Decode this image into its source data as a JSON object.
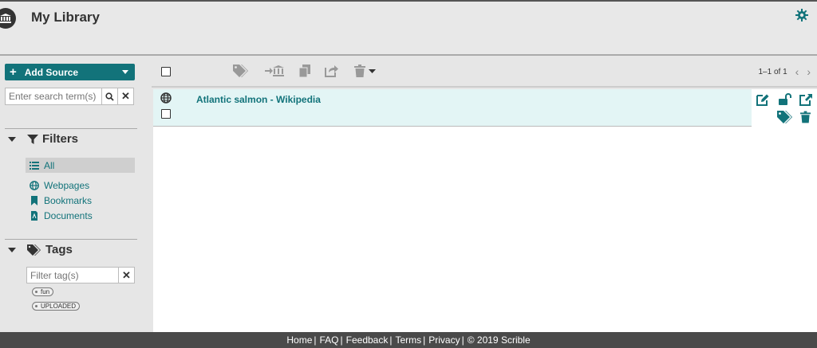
{
  "header": {
    "title": "My Library"
  },
  "sidebar": {
    "add_source_label": "Add Source",
    "search": {
      "placeholder": "Enter search term(s)",
      "value": ""
    },
    "filters": {
      "title": "Filters",
      "items": [
        {
          "label": "All",
          "icon": "list-icon",
          "active": true
        },
        {
          "label": "Webpages",
          "icon": "globe-icon"
        },
        {
          "label": "Bookmarks",
          "icon": "bookmark-icon"
        },
        {
          "label": "Documents",
          "icon": "pdf-icon"
        }
      ]
    },
    "tags": {
      "title": "Tags",
      "filter_placeholder": "Filter tag(s)",
      "items": [
        {
          "label": "fun"
        },
        {
          "label": "UPLOADED"
        }
      ]
    }
  },
  "toolbar": {
    "pagination": "1–1 of 1"
  },
  "items": [
    {
      "title": "Atlantic salmon - Wikipedia",
      "type": "webpage"
    }
  ],
  "footer": {
    "links": [
      "Home",
      "FAQ",
      "Feedback",
      "Terms",
      "Privacy"
    ],
    "copyright": "© 2019 Scrible"
  },
  "colors": {
    "accent": "#12737a",
    "row_highlight": "#e3f5f5",
    "footer_bg": "#4a4a4a"
  }
}
